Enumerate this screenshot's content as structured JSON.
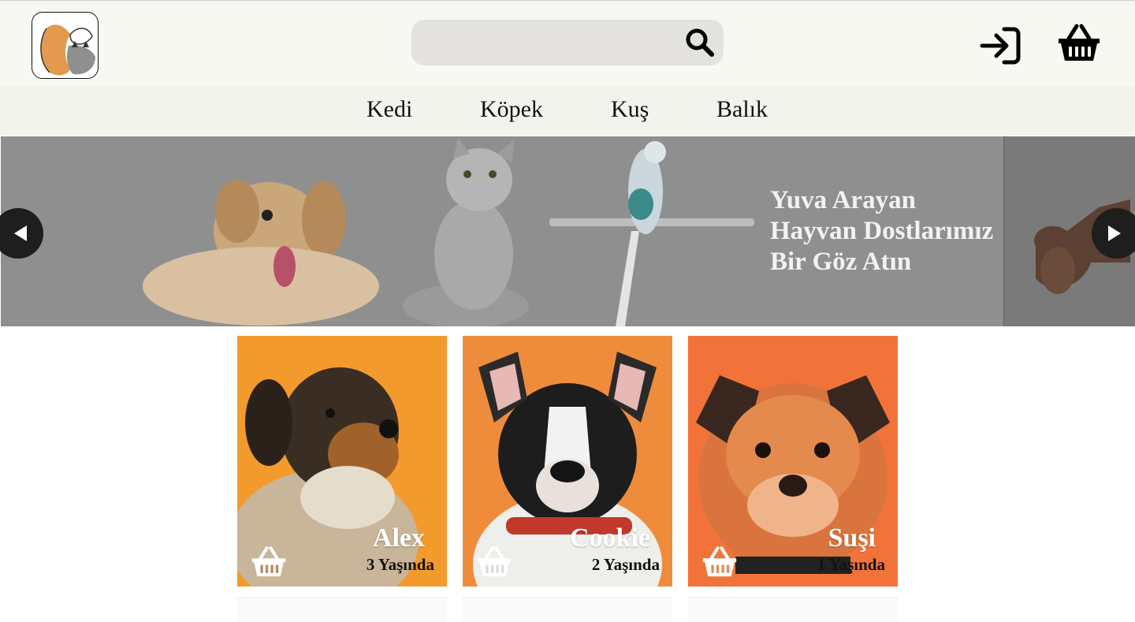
{
  "header": {
    "logo_icon": "dog-cat-logo-icon",
    "search": {
      "placeholder": "",
      "value": "",
      "icon": "search-icon"
    },
    "login_icon": "login-icon",
    "cart_icon": "basket-icon"
  },
  "nav": {
    "items": [
      {
        "label": "Kedi"
      },
      {
        "label": "Köpek"
      },
      {
        "label": "Kuş"
      },
      {
        "label": "Balık"
      }
    ]
  },
  "hero": {
    "lines": [
      "Yuva Arayan",
      "Hayvan Dostlarımız",
      "Bir Göz Atın"
    ],
    "prev_icon": "caret-left-icon",
    "next_icon": "caret-right-icon"
  },
  "cards": [
    {
      "name": "Alex",
      "age": "3 Yaşında",
      "accent": "#f39a2c"
    },
    {
      "name": "Cookie",
      "age": "2 Yaşında",
      "accent": "#ef8c3c"
    },
    {
      "name": "Suşi",
      "age": "1 Yaşında",
      "accent": "#f2733a"
    }
  ],
  "colors": {
    "topbar": "#f8f8f2",
    "navbar": "#f3f3ee",
    "search_bg": "#e4e2df",
    "hero_overlay": "#8f8f8f"
  }
}
